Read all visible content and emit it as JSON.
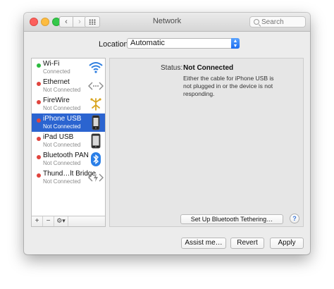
{
  "window": {
    "title": "Network"
  },
  "toolbar": {
    "search_placeholder": "Search"
  },
  "location": {
    "label": "Location:",
    "value": "Automatic"
  },
  "services": [
    {
      "name": "Wi-Fi",
      "status": "Connected",
      "status_color": "#2dbb3f",
      "icon": "wifi-icon",
      "selected": false
    },
    {
      "name": "Ethernet",
      "status": "Not Connected",
      "status_color": "#e0443e",
      "icon": "ethernet-icon",
      "selected": false
    },
    {
      "name": "FireWire",
      "status": "Not Connected",
      "status_color": "#e0443e",
      "icon": "firewire-icon",
      "selected": false
    },
    {
      "name": "iPhone USB",
      "status": "Not Connected",
      "status_color": "#e0443e",
      "icon": "iphone-icon",
      "selected": true
    },
    {
      "name": "iPad USB",
      "status": "Not Connected",
      "status_color": "#e0443e",
      "icon": "ipad-icon",
      "selected": false
    },
    {
      "name": "Bluetooth PAN",
      "status": "Not Connected",
      "status_color": "#e0443e",
      "icon": "bluetooth-icon",
      "selected": false
    },
    {
      "name": "Thund…lt Bridge",
      "status": "Not Connected",
      "status_color": "#e0443e",
      "icon": "thunderbolt-bridge-icon",
      "selected": false
    }
  ],
  "sidebar_toolbar": {
    "add": "+",
    "remove": "−",
    "gear": "⚙▾"
  },
  "detail": {
    "status_label": "Status:",
    "status_value": "Not Connected",
    "status_description": "Either the cable for iPhone USB is not plugged in or the device is not responding.",
    "tether_button": "Set Up Bluetooth Tethering…",
    "help": "?"
  },
  "buttons": {
    "assist": "Assist me…",
    "revert": "Revert",
    "apply": "Apply"
  },
  "colors": {
    "selection": "#2b64d0",
    "accent": "#1a6cf0"
  }
}
